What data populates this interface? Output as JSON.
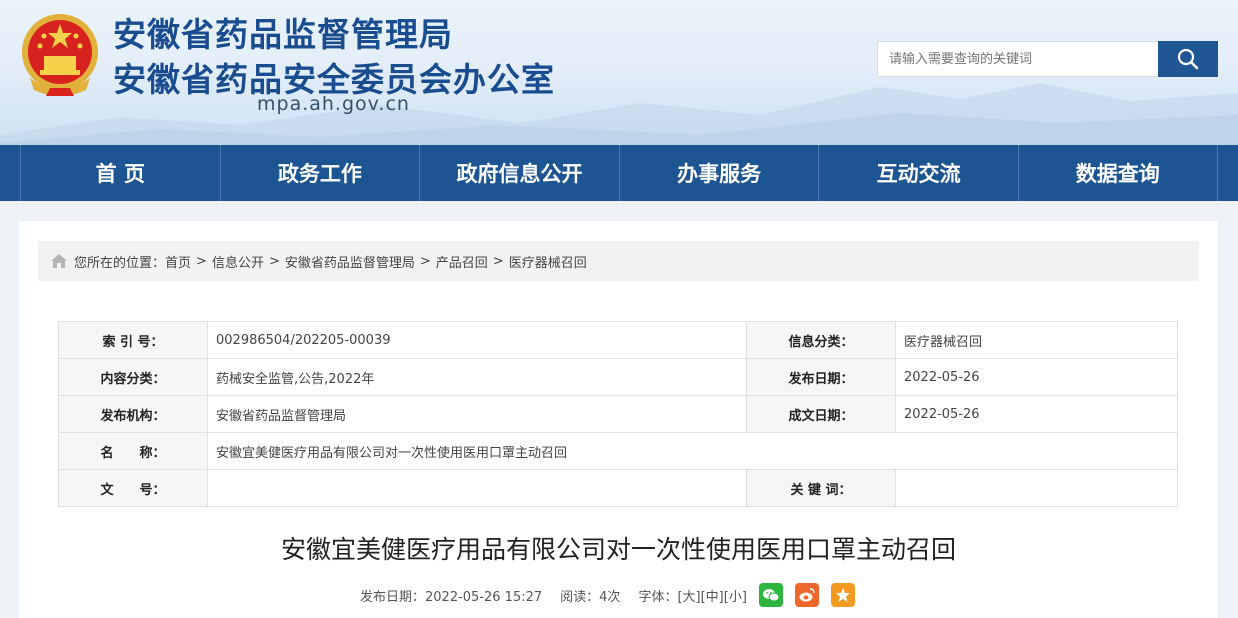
{
  "header": {
    "title_line1": "安徽省药品监督管理局",
    "title_line2": "安徽省药品安全委员会办公室",
    "domain": "mpa.ah.gov.cn",
    "search_placeholder": "请输入需要查询的关键词"
  },
  "nav": {
    "items": [
      {
        "label": "首 页"
      },
      {
        "label": "政务工作"
      },
      {
        "label": "政府信息公开"
      },
      {
        "label": "办事服务"
      },
      {
        "label": "互动交流"
      },
      {
        "label": "数据查询"
      }
    ]
  },
  "breadcrumb": {
    "prefix": "您所在的位置：",
    "items": [
      "首页",
      "信息公开",
      "安徽省药品监督管理局",
      "产品召回",
      "医疗器械召回"
    ],
    "separator": ">"
  },
  "meta": {
    "index_label": "索 引 号：",
    "index_value": "002986504/202205-00039",
    "category_label": "信息分类：",
    "category_value": "医疗器械召回",
    "content_type_label": "内容分类：",
    "content_type_value": "药械安全监管,公告,2022年",
    "publish_date_label": "发布日期：",
    "publish_date_value": "2022-05-26",
    "publisher_label": "发布机构：",
    "publisher_value": "安徽省药品监督管理局",
    "created_date_label": "成文日期：",
    "created_date_value": "2022-05-26",
    "name_label": "名　　称：",
    "name_value": "安徽宜美健医疗用品有限公司对一次性使用医用口罩主动召回",
    "doc_no_label": "文　　号：",
    "doc_no_value": "",
    "keywords_label": "关 键 词：",
    "keywords_value": ""
  },
  "article": {
    "title": "安徽宜美健医疗用品有限公司对一次性使用医用口罩主动召回",
    "publish_text": "发布日期：2022-05-26 15:27",
    "views_text": "阅读：4次",
    "font_label": "字体：",
    "size_large": "[大]",
    "size_medium": "[中]",
    "size_small": "[小]"
  },
  "colors": {
    "brand_blue": "#1d5593",
    "title_blue": "#1a4c90",
    "wechat_green": "#2db63f",
    "weibo_orange": "#f0672c",
    "favorite_orange": "#f29a22"
  },
  "icons": [
    "national-emblem-icon",
    "search-icon",
    "home-icon",
    "wechat-icon",
    "weibo-icon",
    "favorite-star-icon"
  ]
}
